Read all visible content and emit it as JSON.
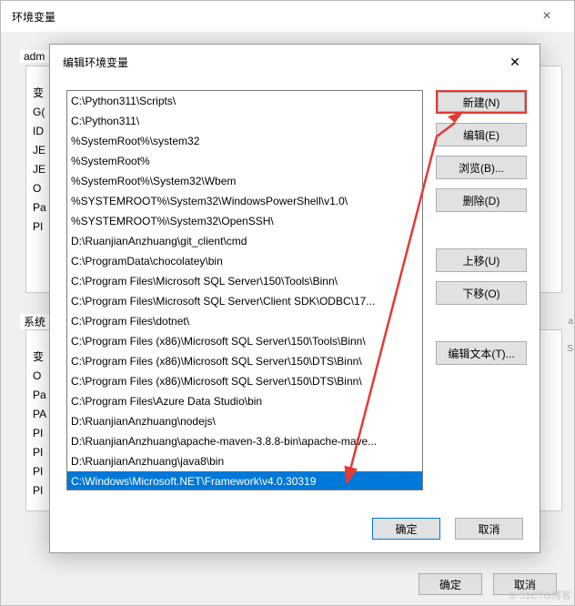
{
  "back": {
    "title": "环境变量",
    "user_label": "adm",
    "sys_label": "系统",
    "user_vars": [
      "变",
      "G(",
      "ID",
      "JE",
      "JE",
      "O",
      "Pa",
      "PI"
    ],
    "sys_vars": [
      "变",
      "O",
      "Pa",
      "PA",
      "PI",
      "PI",
      "PI",
      "PI"
    ],
    "ok": "确定",
    "cancel": "取消"
  },
  "front": {
    "title": "编辑环境变量",
    "paths": [
      "C:\\Python311\\Scripts\\",
      "C:\\Python311\\",
      "%SystemRoot%\\system32",
      "%SystemRoot%",
      "%SystemRoot%\\System32\\Wbem",
      "%SYSTEMROOT%\\System32\\WindowsPowerShell\\v1.0\\",
      "%SYSTEMROOT%\\System32\\OpenSSH\\",
      "D:\\RuanjianAnzhuang\\git_client\\cmd",
      "C:\\ProgramData\\chocolatey\\bin",
      "C:\\Program Files\\Microsoft SQL Server\\150\\Tools\\Binn\\",
      "C:\\Program Files\\Microsoft SQL Server\\Client SDK\\ODBC\\17...",
      "C:\\Program Files\\dotnet\\",
      "C:\\Program Files (x86)\\Microsoft SQL Server\\150\\Tools\\Binn\\",
      "C:\\Program Files (x86)\\Microsoft SQL Server\\150\\DTS\\Binn\\",
      "C:\\Program Files (x86)\\Microsoft SQL Server\\150\\DTS\\Binn\\",
      "C:\\Program Files\\Azure Data Studio\\bin",
      "D:\\RuanjianAnzhuang\\nodejs\\",
      "D:\\RuanjianAnzhuang\\apache-maven-3.8.8-bin\\apache-mave...",
      "D:\\RuanjianAnzhuang\\java8\\bin",
      "C:\\Windows\\Microsoft.NET\\Framework\\v4.0.30319"
    ],
    "selected_index": 19,
    "buttons": {
      "new": "新建(N)",
      "edit": "编辑(E)",
      "browse": "浏览(B)...",
      "delete": "删除(D)",
      "moveup": "上移(U)",
      "movedown": "下移(O)",
      "edittext": "编辑文本(T)..."
    },
    "ok": "确定",
    "cancel": "取消"
  },
  "right": {
    "a": "a",
    "s": "S",
    "arrow": "⇨"
  },
  "watermark": "⊙ 51CTO博客"
}
